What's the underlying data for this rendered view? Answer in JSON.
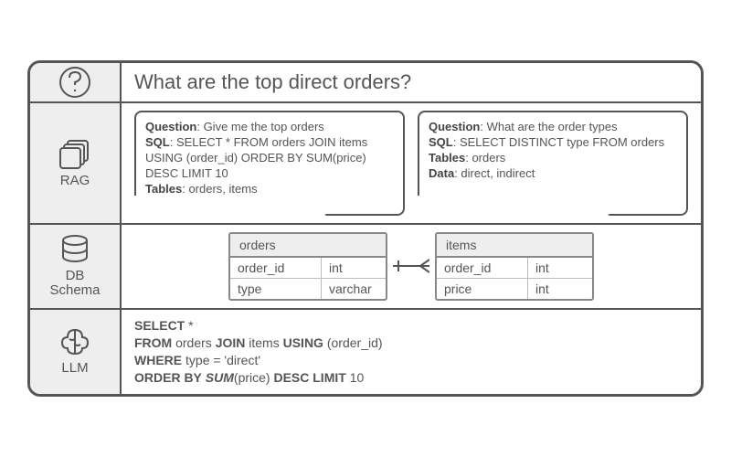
{
  "question": {
    "text": "What are the top direct orders?"
  },
  "rag": {
    "label": "RAG",
    "examples": [
      {
        "question_label": "Question",
        "question": ": Give me the top orders",
        "sql_label": "SQL",
        "sql": ": SELECT * FROM orders JOIN items USING (order_id) ORDER BY SUM(price) DESC LIMIT 10",
        "tables_label": "Tables",
        "tables": ": orders, items"
      },
      {
        "question_label": "Question",
        "question": ": What are the order types",
        "sql_label": "SQL",
        "sql": ": SELECT DISTINCT type FROM orders",
        "tables_label": "Tables",
        "tables": ": orders",
        "data_label": "Data",
        "data": ": direct, indirect"
      }
    ]
  },
  "schema": {
    "label_line1": "DB",
    "label_line2": "Schema",
    "tables": [
      {
        "name": "orders",
        "columns": [
          {
            "name": "order_id",
            "type": "int"
          },
          {
            "name": "type",
            "type": "varchar"
          }
        ]
      },
      {
        "name": "items",
        "columns": [
          {
            "name": "order_id",
            "type": "int"
          },
          {
            "name": "price",
            "type": "int"
          }
        ]
      }
    ]
  },
  "llm": {
    "label": "LLM",
    "sql_lines": {
      "l1a": "SELECT",
      "l1b": " *",
      "l2a": "FROM",
      "l2b": " orders ",
      "l2c": "JOIN",
      "l2d": " items ",
      "l2e": "USING",
      "l2f": " (order_id)",
      "l3a": "WHERE",
      "l3b": " type = 'direct'",
      "l4a": "ORDER BY",
      "l4b": " SUM",
      "l4c": "(price) ",
      "l4d": "DESC LIMIT",
      "l4e": " 10"
    }
  }
}
